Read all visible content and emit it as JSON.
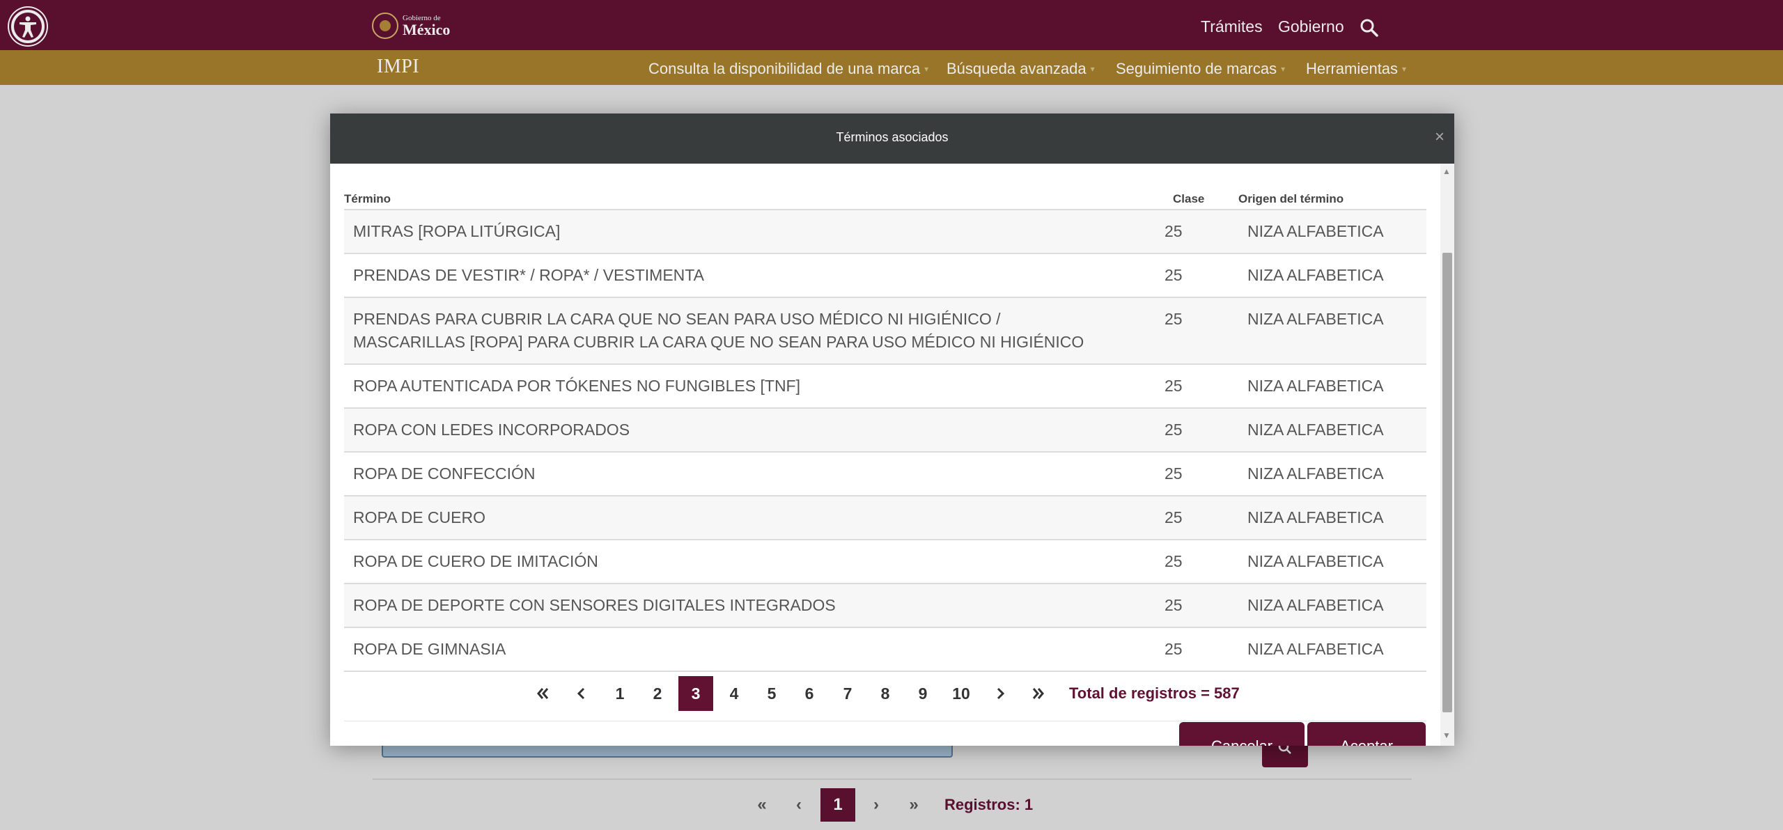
{
  "header": {
    "gob_small": "Gobierno de",
    "gob_big": "México",
    "links": [
      "Trámites",
      "Gobierno"
    ],
    "subtitle": "IMPI",
    "menu": [
      "Consulta la disponibilidad de una marca",
      "Búsqueda avanzada",
      "Seguimiento de marcas",
      "Herramientas"
    ]
  },
  "modal": {
    "title": "Términos asociados",
    "close": "×",
    "columns": [
      "Término",
      "Clase",
      "Origen del término"
    ],
    "rows": [
      {
        "term": "MITRAS [ROPA LITÚRGICA]",
        "clase": "25",
        "origen": "NIZA ALFABETICA"
      },
      {
        "term": "PRENDAS DE VESTIR* / ROPA* / VESTIMENTA",
        "clase": "25",
        "origen": "NIZA ALFABETICA"
      },
      {
        "term": "PRENDAS PARA CUBRIR LA CARA QUE NO SEAN PARA USO MÉDICO NI HIGIÉNICO / MASCARILLAS [ROPA] PARA CUBRIR LA CARA QUE NO SEAN PARA USO MÉDICO NI HIGIÉNICO",
        "clase": "25",
        "origen": "NIZA ALFABETICA"
      },
      {
        "term": "ROPA AUTENTICADA POR TÓKENES NO FUNGIBLES [TNF]",
        "clase": "25",
        "origen": "NIZA ALFABETICA"
      },
      {
        "term": "ROPA CON LEDES INCORPORADOS",
        "clase": "25",
        "origen": "NIZA ALFABETICA"
      },
      {
        "term": "ROPA DE CONFECCIÓN",
        "clase": "25",
        "origen": "NIZA ALFABETICA"
      },
      {
        "term": "ROPA DE CUERO",
        "clase": "25",
        "origen": "NIZA ALFABETICA"
      },
      {
        "term": "ROPA DE CUERO DE IMITACIÓN",
        "clase": "25",
        "origen": "NIZA ALFABETICA"
      },
      {
        "term": "ROPA DE DEPORTE CON SENSORES DIGITALES INTEGRADOS",
        "clase": "25",
        "origen": "NIZA ALFABETICA"
      },
      {
        "term": "ROPA DE GIMNASIA",
        "clase": "25",
        "origen": "NIZA ALFABETICA"
      }
    ],
    "pages": [
      "1",
      "2",
      "3",
      "4",
      "5",
      "6",
      "7",
      "8",
      "9",
      "10"
    ],
    "current_page": "3",
    "total": "Total de registros = 587",
    "buttons": {
      "cancel": "Cancelar",
      "accept": "Aceptar"
    }
  },
  "background": {
    "current_page": "1",
    "registros": "Registros: 1"
  },
  "colors": {
    "brand": "#611232",
    "gold": "#a57f2c",
    "modal_header": "#393c3d"
  }
}
